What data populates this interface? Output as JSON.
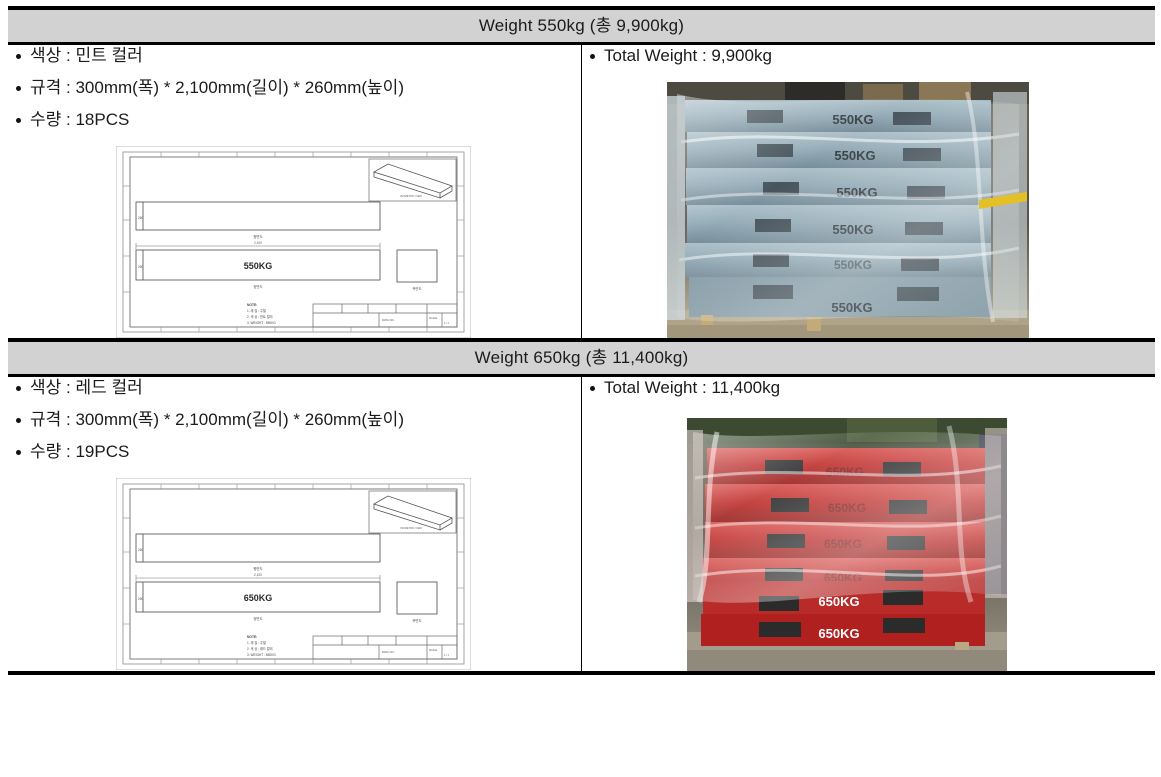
{
  "document": {
    "type": "specification-table",
    "rows": [
      {
        "header": "Weight 550kg (총 9,900kg)",
        "left": {
          "bullets": [
            "색상 : 민트 컬러",
            "규격 : 300mm(폭) * 2,100mm(길이) * 260mm(높이)",
            "수량 : 18PCS"
          ],
          "drawing": {
            "label": "550KG",
            "view_front_label": "정면도",
            "view_top_label": "평면도",
            "view_side_label": "측면도",
            "iso_label": "ISOMETRIC VIEW",
            "dim_length": "2,100",
            "dim_height": "260",
            "notes_title": "NOTE:",
            "notes": [
              "1. 재  질 : 주철",
              "2. 색  상 : 민트 컬러",
              "3. WEIGHT : 550KG"
            ],
            "title_block": {
              "drawing_no": "DWG NO.",
              "scale": "SCALE",
              "sheet": "1 / 1"
            }
          }
        },
        "right": {
          "bullets": [
            "Total Weight : 9,900kg"
          ],
          "photo": {
            "alt": "민트 컬러 웨이트 블록 팔레트 적재 사진",
            "block_color": "#8fa8b4",
            "block_color_dark": "#6e8693",
            "block_color_light": "#a8bcc6",
            "stencil_label": "550KG",
            "layers": 6,
            "ground_color": "#b5a98d",
            "wrap_color": "#d8e2e6",
            "strap_color": "#e4c024"
          }
        }
      },
      {
        "header": "Weight 650kg (총 11,400kg)",
        "left": {
          "bullets": [
            "색상 : 레드 컬러",
            "규격 : 300mm(폭) * 2,100mm(길이) * 260mm(높이)",
            "수량 : 19PCS"
          ],
          "drawing": {
            "label": "650KG",
            "view_front_label": "정면도",
            "view_top_label": "평면도",
            "view_side_label": "측면도",
            "iso_label": "ISOMETRIC VIEW",
            "dim_length": "2,100",
            "dim_height": "260",
            "notes_title": "NOTE:",
            "notes": [
              "1. 재  질 : 주철",
              "2. 색  상 : 레드 컬러",
              "3. WEIGHT : 650KG"
            ],
            "title_block": {
              "drawing_no": "DWG NO.",
              "scale": "SCALE",
              "sheet": "1 / 1"
            }
          }
        },
        "right": {
          "bullets": [
            "Total Weight : 11,400kg"
          ],
          "photo": {
            "alt": "레드 컬러 웨이트 블록 팔레트 적재 사진",
            "block_color": "#c0302e",
            "block_color_dark": "#96211f",
            "block_color_light": "#d8534f",
            "stencil_label": "650KG",
            "layers": 6,
            "ground_color": "#9a9386",
            "wrap_color": "#e8d8d4",
            "strap_color": "#e0d8c8"
          }
        }
      }
    ]
  },
  "colors": {
    "header_bg": "#d2d2d2",
    "border": "#000000",
    "text": "#1b1b1b"
  }
}
